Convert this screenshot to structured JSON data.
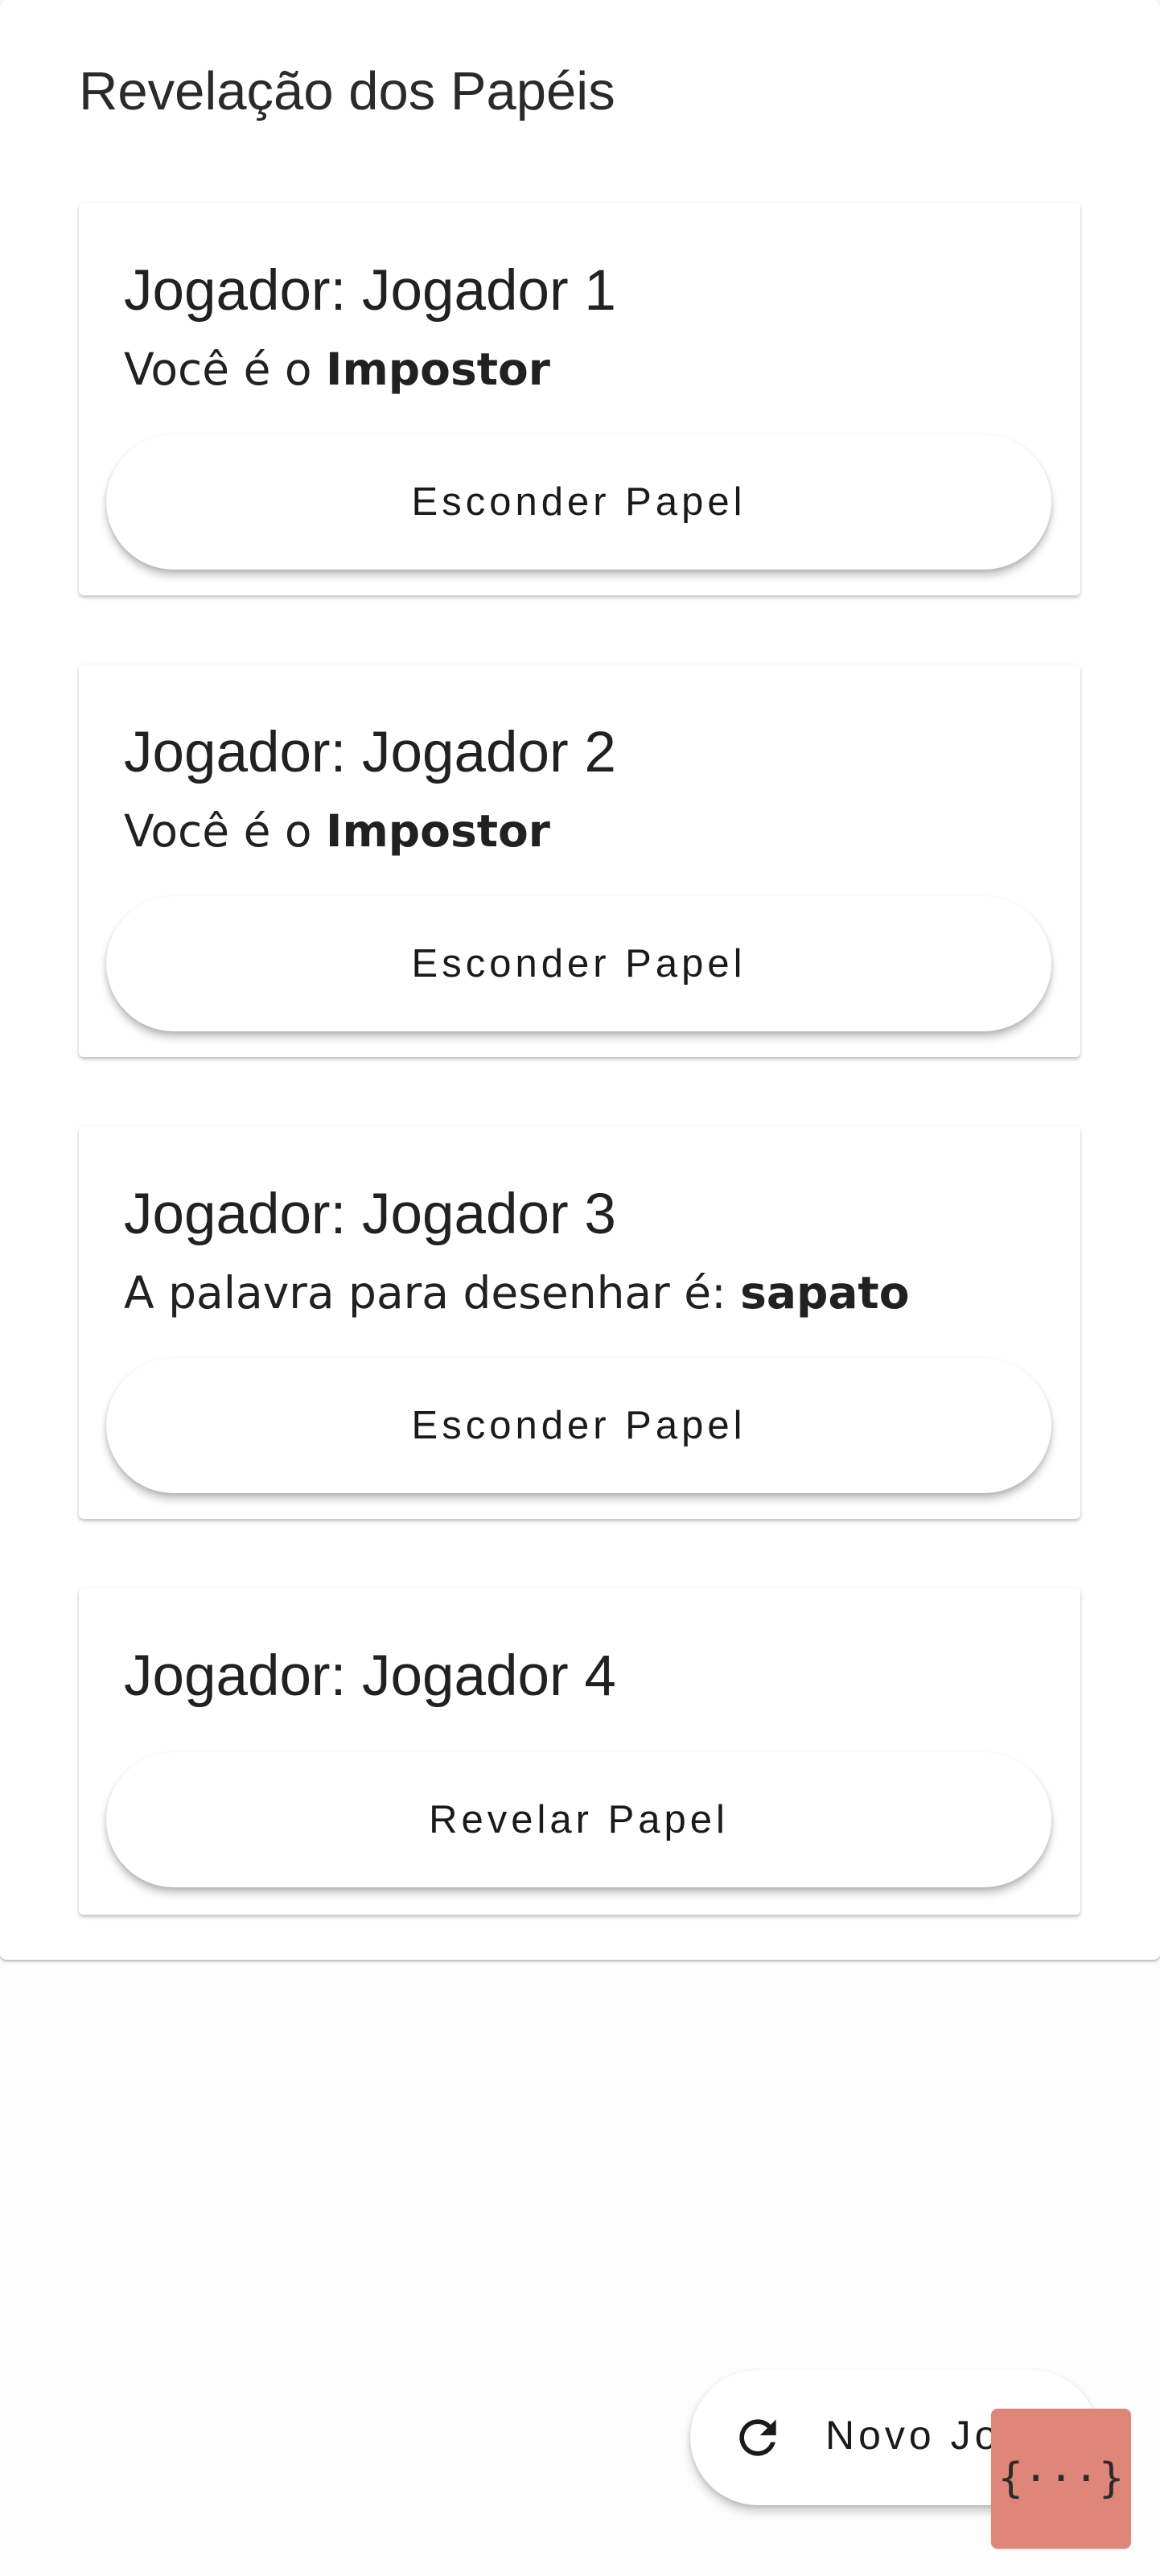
{
  "page": {
    "title": "Revelação dos Papéis"
  },
  "players": [
    {
      "name": "Jogador: Jogador 1",
      "role_prefix": "Você é o ",
      "role_value": "Impostor",
      "button_label": "Esconder Papel"
    },
    {
      "name": "Jogador: Jogador 2",
      "role_prefix": "Você é o ",
      "role_value": "Impostor",
      "button_label": "Esconder Papel"
    },
    {
      "name": "Jogador: Jogador 3",
      "role_prefix": "A palavra para desenhar é: ",
      "role_value": "sapato",
      "button_label": "Esconder Papel"
    },
    {
      "name": "Jogador: Jogador 4",
      "button_label": "Revelar Papel"
    }
  ],
  "fab": {
    "label": "Novo Jogo",
    "icon": "refresh-icon"
  },
  "devtools": {
    "label": "{···}",
    "color": "#df867a"
  }
}
